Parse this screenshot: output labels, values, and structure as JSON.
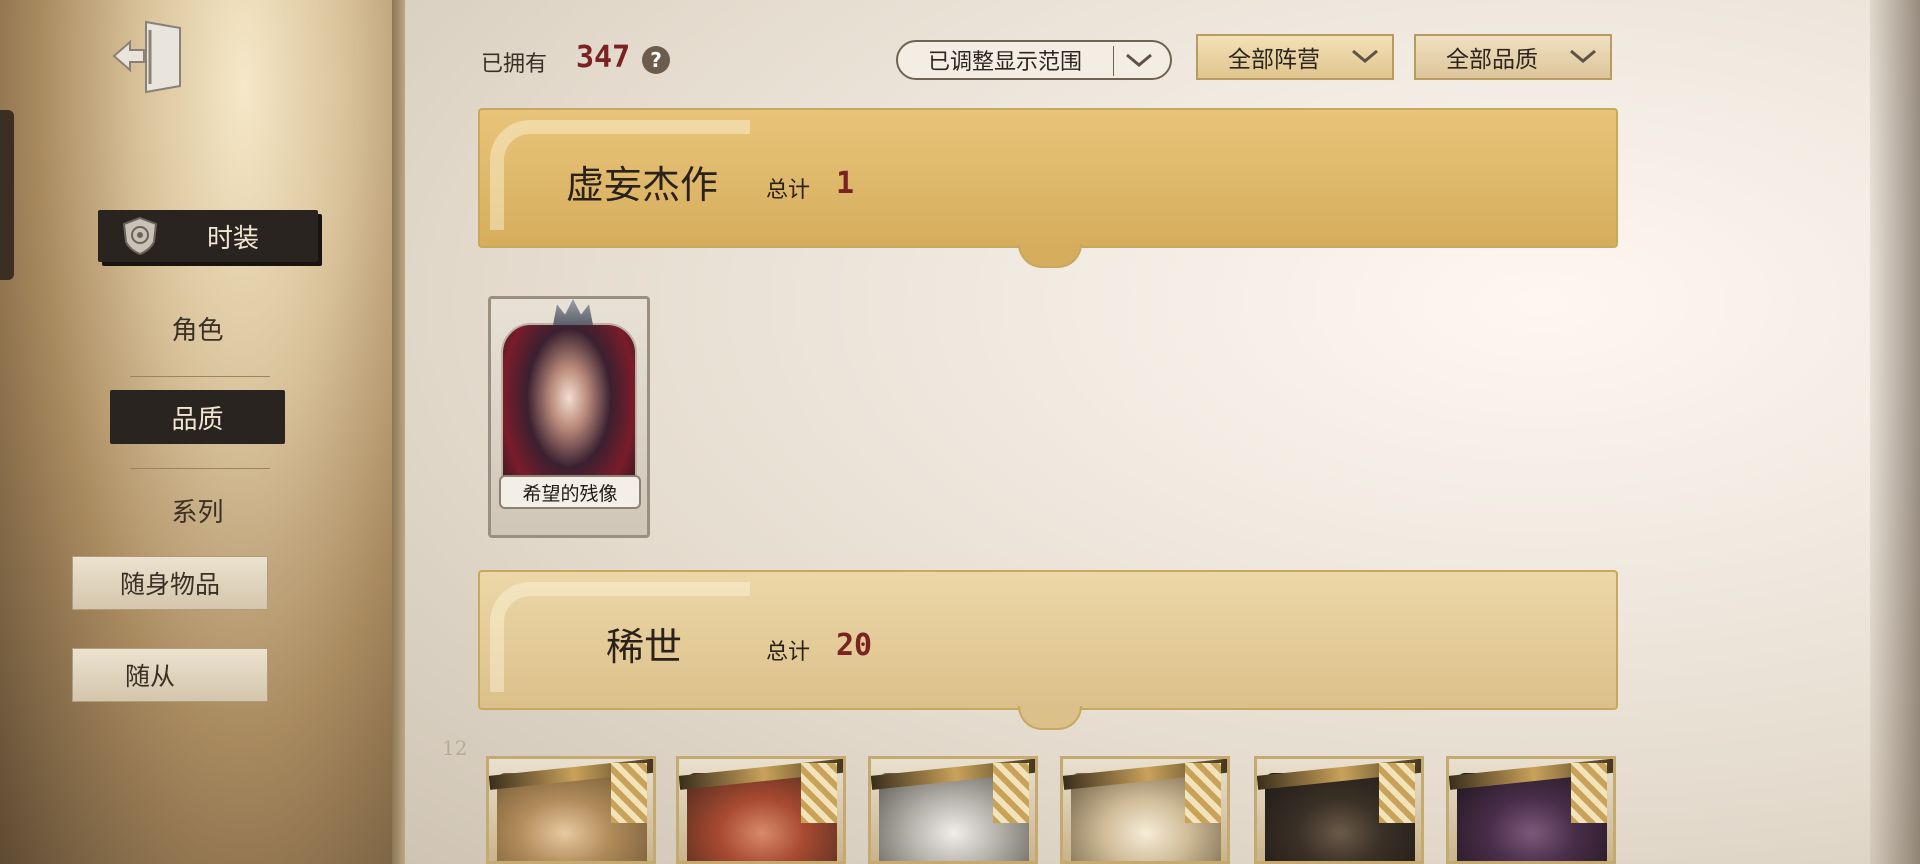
{
  "sidebar": {
    "exit_icon": "exit-door-icon",
    "items": [
      {
        "label": "时装",
        "icon": "shield-badge-icon",
        "selected": true
      },
      {
        "label": "角色",
        "selected": false
      },
      {
        "label": "品质",
        "selected": true
      },
      {
        "label": "系列",
        "selected": false
      },
      {
        "label": "随身物品",
        "selected": false
      },
      {
        "label": "随从",
        "selected": false
      }
    ]
  },
  "header": {
    "owned_label": "已拥有",
    "owned_count": "347",
    "help_icon": "?",
    "filters": {
      "range": "已调整显示范围",
      "camp": "全部阵营",
      "quality": "全部品质"
    }
  },
  "sections": [
    {
      "title": "虚妄杰作",
      "total_label": "总计",
      "total_value": "1",
      "cards": [
        {
          "name": "希望的残像"
        }
      ]
    },
    {
      "title": "稀世",
      "total_label": "总计",
      "total_value": "20",
      "cards_visible": 6
    }
  ],
  "ghost_number": "12",
  "colors": {
    "accent_red": "#7a2222",
    "banner_gold": "#d6ad5c",
    "dark_tab": "#2a2420"
  }
}
